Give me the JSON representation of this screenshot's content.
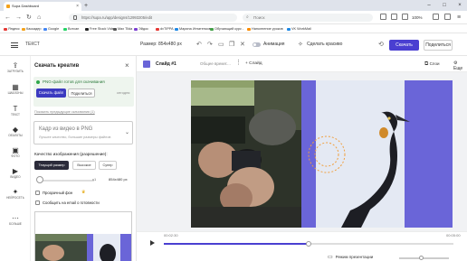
{
  "browser": {
    "tab_title": "Supa Dashboard",
    "new_tab": "+",
    "url": "https://supa.ru/app/designs/12993205/edit",
    "search_placeholder": "Поиск",
    "zoom": "100%",
    "bookmarks": [
      {
        "label": "Яндекс",
        "color": "#e53935"
      },
      {
        "label": "Каскадер",
        "color": "#f4a11a"
      },
      {
        "label": "Google",
        "color": "#4285f4"
      },
      {
        "label": "Вотсап",
        "color": "#25d366"
      },
      {
        "label": "Free Stock Video",
        "color": "#222222"
      },
      {
        "label": "Max Tilda",
        "color": "#555555"
      },
      {
        "label": "Эйдос",
        "color": "#7b3fd1"
      },
      {
        "label": "dvTIPPA",
        "color": "#e53935"
      },
      {
        "label": "Марина Игнатенкова",
        "color": "#1e88e5"
      },
      {
        "label": "Обучающий курс -",
        "color": "#43a047"
      },
      {
        "label": "Наполнение уроков",
        "color": "#fb8c00"
      },
      {
        "label": "VK WorkMail",
        "color": "#1e88e5"
      }
    ]
  },
  "header": {
    "title": "ТЕКСТ",
    "size_label": "Размер: 854x480 px",
    "animation_label": "Анимация",
    "make_pretty_label": "Сделать красиво",
    "download_label": "Скачать",
    "share_label": "Поделиться"
  },
  "sidebar": {
    "items": [
      {
        "label": "ЗАГРУЗИТЬ",
        "icon": "upload-icon",
        "glyph": "⇪"
      },
      {
        "label": "ШАБЛОНЫ",
        "icon": "templates-icon",
        "glyph": "▦"
      },
      {
        "label": "ТЕКСТ",
        "icon": "text-icon",
        "glyph": "T"
      },
      {
        "label": "ОБЪЕКТЫ",
        "icon": "objects-icon",
        "glyph": "◆"
      },
      {
        "label": "ФОТО",
        "icon": "photo-icon",
        "glyph": "▣"
      },
      {
        "label": "ВИДЕО",
        "icon": "video-icon",
        "glyph": "▶"
      },
      {
        "label": "НЕЙРОСЕТЬ",
        "icon": "ai-icon",
        "glyph": "✦"
      },
      {
        "label": "БОЛЬШЕ",
        "icon": "more-icon",
        "glyph": "⋯"
      }
    ]
  },
  "download_panel": {
    "title": "Скачать креатив",
    "ready_text": "PNG-файл готов для скачивания",
    "download_file_label": "Скачать файл",
    "share_file_label": "Поделиться",
    "date_label": "сегодня",
    "previous_link": "Показать предыдущие скачивания (1)",
    "format_value": "Кадр из видео в PNG",
    "format_desc": "Лучшее качество, большие размеры файлов",
    "quality_label": "Качество изображения (разрешение):",
    "quality_options": [
      "Текущий размер",
      "Высокое",
      "Супер"
    ],
    "quality_selected": 0,
    "scale_label": "x1",
    "dimensions": "854x480 px",
    "transparent_bg_label": "Прозрачный фон",
    "email_notify_label": "Сообщить на email о готовности"
  },
  "slide_toolbar": {
    "slide_name": "Слайд #1",
    "duration": "Общее время:...",
    "add_slide_label": "Слайд",
    "layers_label": "Слои",
    "more_label": "Еще"
  },
  "playback": {
    "time_start": "00:02:30",
    "time_end": "00:05:00",
    "progress": 0.5,
    "presentation_mode_label": "Режим презентации"
  },
  "colors": {
    "accent": "#4a3fd1",
    "stage_purple": "#6a65d8",
    "ready_green": "#2fa74a"
  }
}
